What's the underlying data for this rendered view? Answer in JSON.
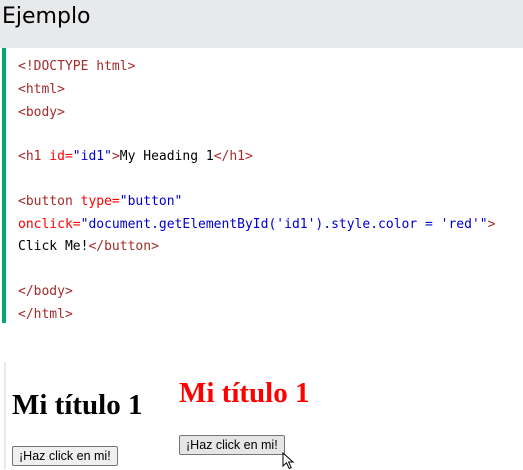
{
  "header": {
    "title": "Ejemplo"
  },
  "code": {
    "l1_tag": "<!DOCTYPE html>",
    "l2_tag": "<html>",
    "l3_tag": "<body>",
    "l5_open": "<h1",
    "l5_attr": " id=",
    "l5_val": "\"id1\"",
    "l5_close": ">",
    "l5_text": "My Heading 1",
    "l5_end": "</h1>",
    "l7_open": "<button",
    "l7_attr": " type=",
    "l7_val": "\"button\"",
    "l8_attr": "onclick=",
    "l8_val": "\"document.getElementById('id1').style.color = 'red'\"",
    "l8_close": ">",
    "l9_text": "Click Me!",
    "l9_end": "</button>",
    "l11_tag": "</body>",
    "l12_tag": "</html>"
  },
  "demo": {
    "left_heading": "Mi título 1",
    "left_button": "¡Haz click en mi!",
    "right_heading": "Mi título 1",
    "right_button": "¡Haz click en mi!",
    "right_heading_color": "#ff0000",
    "cursor_icon": "mouse-pointer-icon"
  },
  "colors": {
    "code_tag": "#a52a2a",
    "code_attr": "#ff0000",
    "code_value": "#0000cd",
    "accent_bar": "#04aa6d",
    "header_bg": "#e7e9eb"
  }
}
